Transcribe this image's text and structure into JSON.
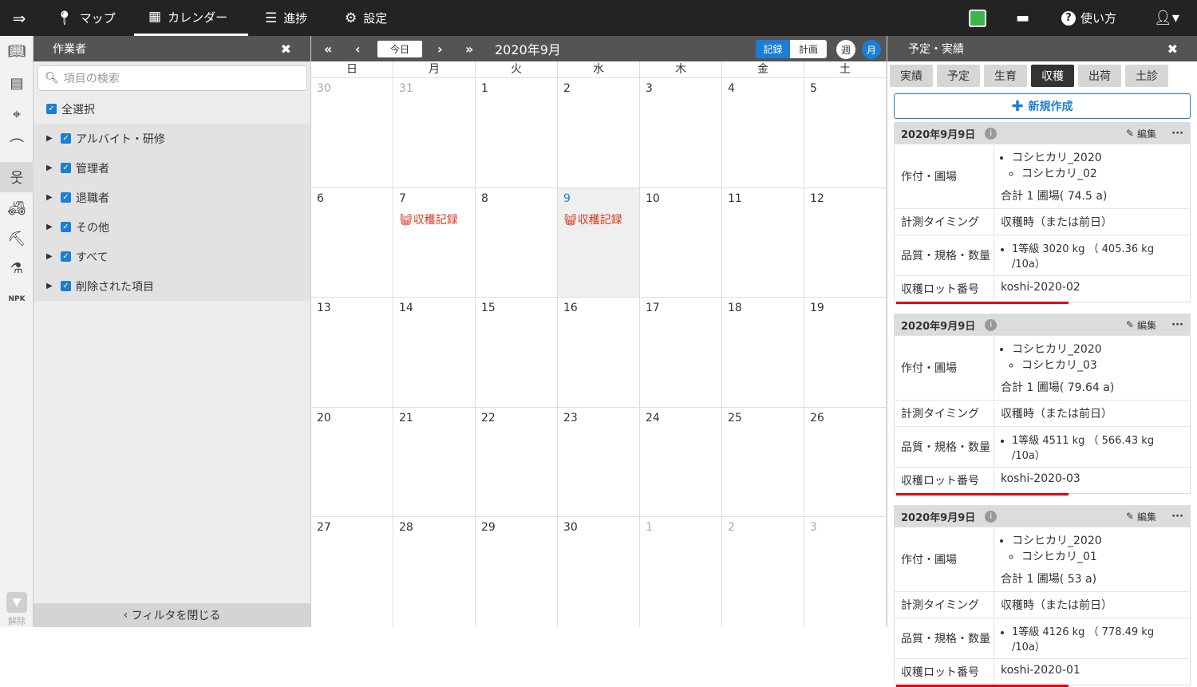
{
  "nav": {
    "map": "マップ",
    "calendar": "カレンダー",
    "progress": "進捗",
    "settings": "設定",
    "help": "使い方"
  },
  "sidebar": {
    "clear_label": "解除"
  },
  "filter": {
    "title": "作業者",
    "search_placeholder": "項目の検索",
    "select_all": "全選択",
    "groups": [
      "アルバイト・研修",
      "管理者",
      "退職者",
      "その他",
      "すべて",
      "削除された項目"
    ],
    "close_label": "フィルタを閉じる"
  },
  "calendar": {
    "today": "今日",
    "month_title": "2020年9月",
    "mode_record": "記録",
    "mode_plan": "計画",
    "view_week": "週",
    "view_month": "月",
    "weekdays": [
      "日",
      "月",
      "火",
      "水",
      "木",
      "金",
      "土"
    ],
    "weeks": [
      [
        "30",
        "31",
        "1",
        "2",
        "3",
        "4",
        "5"
      ],
      [
        "6",
        "7",
        "8",
        "9",
        "10",
        "11",
        "12"
      ],
      [
        "13",
        "14",
        "15",
        "16",
        "17",
        "18",
        "19"
      ],
      [
        "20",
        "21",
        "22",
        "23",
        "24",
        "25",
        "26"
      ],
      [
        "27",
        "28",
        "29",
        "30",
        "1",
        "2",
        "3"
      ]
    ],
    "event_label": "収穫記録"
  },
  "panel": {
    "title": "予定・実績",
    "tabs": [
      "実績",
      "予定",
      "生育",
      "収穫",
      "出荷",
      "土診"
    ],
    "new_label": "新規作成",
    "edit_label": "編集",
    "labels": {
      "crop": "作付・圃場",
      "timing": "計測タイミング",
      "quality": "品質・規格・数量",
      "lot": "収穫ロット番号"
    },
    "cards": [
      {
        "date": "2020年9月9日",
        "crop": "コシヒカリ_2020",
        "field": "コシヒカリ_02",
        "total": "合計 1 圃場( 74.5 a)",
        "timing": "収穫時（または前日）",
        "quality": "1等級 3020 kg （ 405.36 kg /10a）",
        "lot": "koshi-2020-02"
      },
      {
        "date": "2020年9月9日",
        "crop": "コシヒカリ_2020",
        "field": "コシヒカリ_03",
        "total": "合計 1 圃場( 79.64 a)",
        "timing": "収穫時（または前日）",
        "quality": "1等級 4511 kg （ 566.43 kg /10a）",
        "lot": "koshi-2020-03"
      },
      {
        "date": "2020年9月9日",
        "crop": "コシヒカリ_2020",
        "field": "コシヒカリ_01",
        "total": "合計 1 圃場( 53 a)",
        "timing": "収穫時（または前日）",
        "quality": "1等級 4126 kg （ 778.49 kg /10a）",
        "lot": "koshi-2020-01"
      }
    ]
  },
  "colors": {
    "accent": "#1a7fd4",
    "event": "#d9381e",
    "underline": "#e3000f",
    "header": "#545454",
    "topbar": "#232323"
  }
}
